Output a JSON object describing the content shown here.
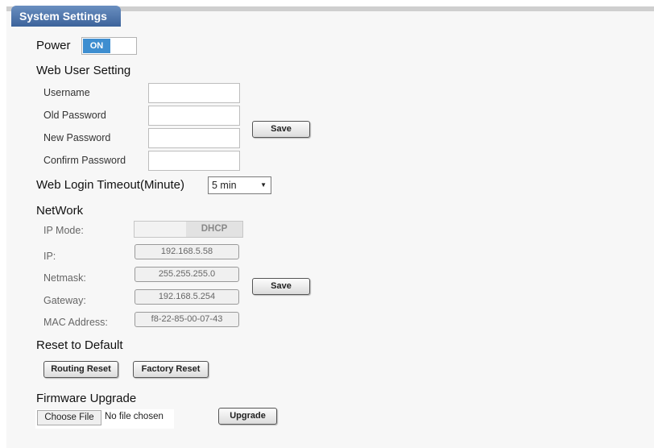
{
  "section_tab": "System Settings",
  "power": {
    "label": "Power",
    "state": "ON"
  },
  "web_user": {
    "heading": "Web User Setting",
    "fields": [
      {
        "label": "Username",
        "value": ""
      },
      {
        "label": "Old Password",
        "value": ""
      },
      {
        "label": "New Password",
        "value": ""
      },
      {
        "label": "Confirm Password",
        "value": ""
      }
    ],
    "save_label": "Save"
  },
  "timeout": {
    "label": "Web Login Timeout(Minute)",
    "selected": "5 min"
  },
  "network": {
    "heading": "NetWork",
    "ip_mode": {
      "label": "IP Mode:",
      "value": "DHCP"
    },
    "ip": {
      "label": "IP:",
      "value": "192.168.5.58"
    },
    "netmask": {
      "label": "Netmask:",
      "value": "255.255.255.0"
    },
    "gateway": {
      "label": "Gateway:",
      "value": "192.168.5.254"
    },
    "mac": {
      "label": "MAC Address:",
      "value": "f8-22-85-00-07-43"
    },
    "save_label": "Save"
  },
  "reset": {
    "heading": "Reset to Default",
    "routing_reset_label": "Routing Reset",
    "factory_reset_label": "Factory Reset"
  },
  "firmware": {
    "heading": "Firmware Upgrade",
    "choose_file_label": "Choose File",
    "file_status": "No file chosen",
    "upgrade_label": "Upgrade"
  },
  "colors": {
    "accent": "#3e8ed0",
    "tab": "#4a72a8"
  }
}
